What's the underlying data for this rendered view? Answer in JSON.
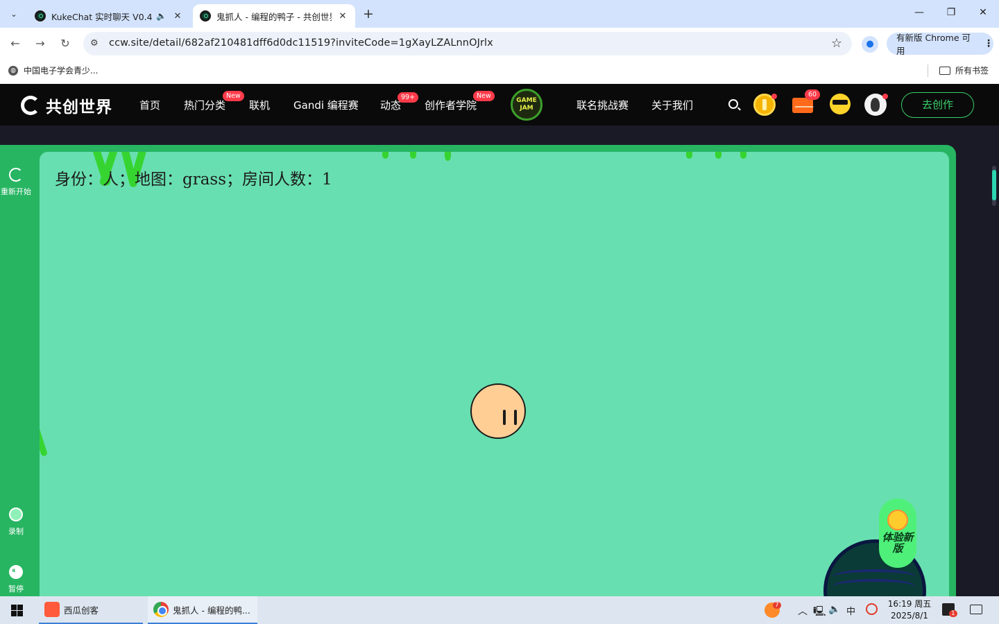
{
  "browser": {
    "tabs": [
      {
        "title": "KukeChat 实时聊天 V0.4 -",
        "has_audio": true
      },
      {
        "title": "鬼抓人 - 编程的鸭子 - 共创世界",
        "active": true
      }
    ],
    "new_tab_symbol": "+",
    "url": "ccw.site/detail/682af210481dff6d0dc11519?inviteCode=1gXayLZALnnOJrlx",
    "update_label": "有新版 Chrome 可用",
    "bookmark": "中国电子学会青少...",
    "all_bookmarks": "所有书签"
  },
  "site": {
    "logo_text": "共创世界",
    "nav": [
      {
        "label": "首页"
      },
      {
        "label": "热门分类",
        "badge": "New"
      },
      {
        "label": "联机"
      },
      {
        "label": "Gandi 编程赛"
      },
      {
        "label": "动态",
        "badge": "99+"
      },
      {
        "label": "创作者学院",
        "badge": "New"
      },
      {
        "label": "联名挑战赛"
      },
      {
        "label": "关于我们"
      }
    ],
    "gamejam_text": "GAME JAM",
    "mail_count": "60",
    "create_label": "去创作"
  },
  "player": {
    "left_rail": {
      "restart": "重新开始",
      "record": "录制",
      "pause": "暂停"
    },
    "hud": "身份：人；地图：grass；房间人数：1",
    "try_new": "体验新版"
  },
  "taskbar": {
    "apps": [
      {
        "label": "西瓜创客"
      },
      {
        "label": "鬼抓人 - 编程的鸭..."
      }
    ],
    "tray_badge": "7",
    "ime": "中",
    "time": "16:19 周五",
    "date": "2025/8/1",
    "notify_count": "1"
  },
  "colors": {
    "accent_green": "#27b562",
    "stage_bg": "#68dfb0",
    "create_button": "#39d06a",
    "badge_red": "#ff3b4a"
  }
}
